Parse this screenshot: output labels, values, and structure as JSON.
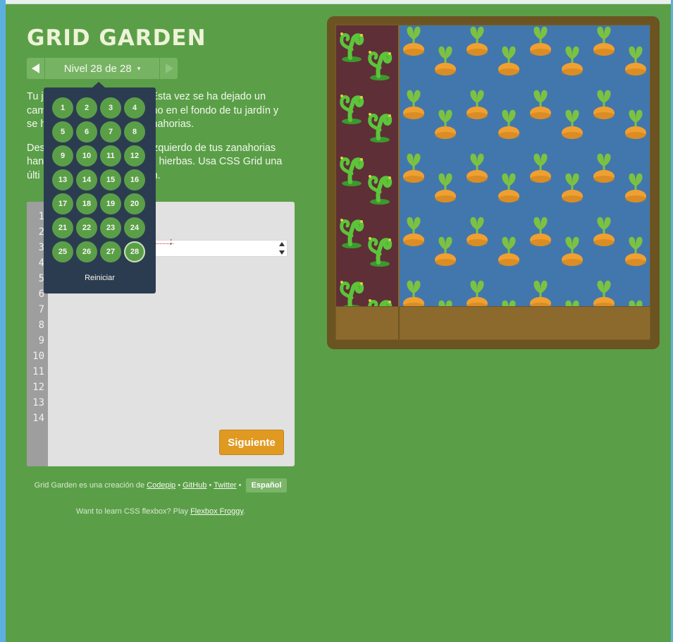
{
  "title": "GRID GARDEN",
  "level_nav": {
    "label": "Nivel 28 de 28",
    "caret": "▾",
    "prev_icon": "triangle-left-icon",
    "next_icon": "triangle-right-icon"
  },
  "instructions": {
    "p1_start": "Tu j",
    "p1_mid": "ial. Esta vez se ha dejado un",
    "p1_line2_start": "cam",
    "p1_line2_end": "ho en el fondo de tu jardín y",
    "p1_line3_start": "se h",
    "p1_line3_end": "nahorias.",
    "p2_start": "Des",
    "p2_mid": "izquierdo de tus zanahorias",
    "p2_line2_start": "han",
    "p2_line2_end": "s hierbas. Usa CSS Grid una",
    "p2_line3_start": "últi",
    "p2_line3_end": "ín."
  },
  "editor": {
    "line_numbers": [
      "1",
      "2",
      "3",
      "4",
      "5",
      "6",
      "7",
      "8",
      "9",
      "10",
      "11",
      "12",
      "13",
      "14"
    ],
    "input_suffix": ";",
    "next_button": "Siguiente"
  },
  "level_menu": {
    "levels": [
      "1",
      "2",
      "3",
      "4",
      "5",
      "6",
      "7",
      "8",
      "9",
      "10",
      "11",
      "12",
      "13",
      "14",
      "15",
      "16",
      "17",
      "18",
      "19",
      "20",
      "21",
      "22",
      "23",
      "24",
      "25",
      "26",
      "27",
      "28"
    ],
    "current": "28",
    "reset_label": "Reiniciar"
  },
  "footer": {
    "line1_prefix": "Grid Garden es una creación de",
    "codepip": "Codepip",
    "sep1": "•",
    "github": "GitHub",
    "sep2": "•",
    "twitter": "Twitter",
    "sep3": "•",
    "language": "Español",
    "line2_prefix": "Want to learn CSS flexbox? Play",
    "flexbox_froggy": "Flexbox Froggy",
    "line2_suffix": "."
  },
  "colors": {
    "background": "#5a9f48",
    "weeds": "#5e2f36",
    "water": "#4177ad",
    "carrot": "#f0a030",
    "leaf": "#7cc242",
    "soil": "#8c6a2e"
  }
}
